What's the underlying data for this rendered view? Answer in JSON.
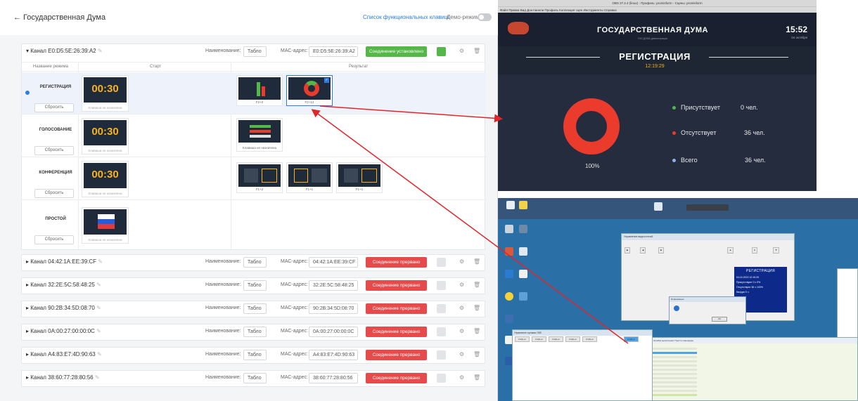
{
  "app": {
    "back_label": "← Государственная Дума",
    "function_keys_link": "Список функциональных клавиш",
    "demo_mode_label": "Демо-режим",
    "demo_mode_on": false
  },
  "labels": {
    "name_label": "Наименование:",
    "mac_label": "МАС-адрес:",
    "col_mode_name": "Название режима",
    "col_start": "Старт",
    "col_result": "Результат",
    "reset_label": "Сбросить",
    "no_key_assigned": "Клавиша не назначена"
  },
  "channels": [
    {
      "name": "Канал E0:D5:5E:26:39:A2",
      "device": "Табло",
      "mac": "E0:D5:5E:26:39:A2",
      "status": "Соединение установлено",
      "status_kind": "ok",
      "expanded": true
    },
    {
      "name": "Канал 04:42:1A:EE:39:CF",
      "device": "Табло",
      "mac": "04:42:1A:EE:39:CF",
      "status": "Соединение прервано",
      "status_kind": "bad",
      "expanded": false
    },
    {
      "name": "Канал 32:2E:5C:58:48:25",
      "device": "Табло",
      "mac": "32:2E:5C:58:48:25",
      "status": "Соединение прервано",
      "status_kind": "bad",
      "expanded": false
    },
    {
      "name": "Канал 90:2B:34:5D:08:70",
      "device": "Табло",
      "mac": "90:2B:34:5D:08:70",
      "status": "Соединение прервано",
      "status_kind": "bad",
      "expanded": false
    },
    {
      "name": "Канал 0A:00:27:00:00:0C",
      "device": "Табло",
      "mac": "0A:00:27:00:00:0C",
      "status": "Соединение прервано",
      "status_kind": "bad",
      "expanded": false
    },
    {
      "name": "Канал A4:83:E7:4D:90:63",
      "device": "Табло",
      "mac": "A4:83:E7:4D:90:63",
      "status": "Соединение прервано",
      "status_kind": "bad",
      "expanded": false
    },
    {
      "name": "Канал 38:60:77:28:80:56",
      "device": "Табло",
      "mac": "38:60:77:28:80:56",
      "status": "Соединение прервано",
      "status_kind": "bad",
      "expanded": false
    }
  ],
  "modes": [
    {
      "name": "РЕГИСТРАЦИЯ",
      "timer": "00:30",
      "selected": true,
      "results": [
        "F2+2",
        "F2+13"
      ]
    },
    {
      "name": "ГОЛОСОВАНИЕ",
      "timer": "00:30",
      "selected": false,
      "results": [
        "Клавиша не назначена"
      ]
    },
    {
      "name": "КОНФЕРЕНЦИЯ",
      "timer": "00:30",
      "selected": false,
      "results": [
        "F1+2",
        "F1+1",
        "F1+1"
      ]
    },
    {
      "name": "ПРОСТОЙ",
      "timer": "",
      "selected": false,
      "results": []
    }
  ],
  "obs": {
    "window_title": "OBS 27.2.4 (linux) - Профиль: promisform - Сцены: promisform",
    "menu": "Файл  Правка  Вид  Док-панели  Профиль  Коллекция сцен  Инструменты  Справка",
    "house": "ГОСУДАРСТВЕННАЯ ДУМА",
    "house_sub": "ГОС.ДУМА демонстрация",
    "clock": "15:52",
    "date": "04 октября",
    "registration_title": "РЕГИСТРАЦИЯ",
    "registration_time": "12:19:29",
    "percent": "100%",
    "legend": [
      {
        "label": "Присутствует",
        "value": "0 чел.",
        "color": "#54b748"
      },
      {
        "label": "Отсутствует",
        "value": "36 чел.",
        "color": "#ea3b2d"
      },
      {
        "label": "Всего",
        "value": "36 чел.",
        "color": "#8fb3e8"
      }
    ]
  },
  "windows_desktop": {
    "main_window_title": "Управление видеостеной",
    "blue_title": "РЕГИСТРАЦИЯ",
    "blue_lines": [
      "04.10.2022 12:19:29",
      "Присутствуют    0 ч  0%",
      "Отсутствуют   36 ч 100%",
      "Кворум        0 ч"
    ],
    "message_title": "Информация",
    "message_ok": "OK",
    "bottom_window_title": "Управление сценами OBS",
    "bottom_tabs": [
      "F4(1)+1",
      "F4(2)+1",
      "F4(2)+1",
      "F4(2)+1",
      "F4(3)+1",
      "F4(3)+1"
    ],
    "right_window_title": "Ошибка вычисления: Просто совещание"
  }
}
